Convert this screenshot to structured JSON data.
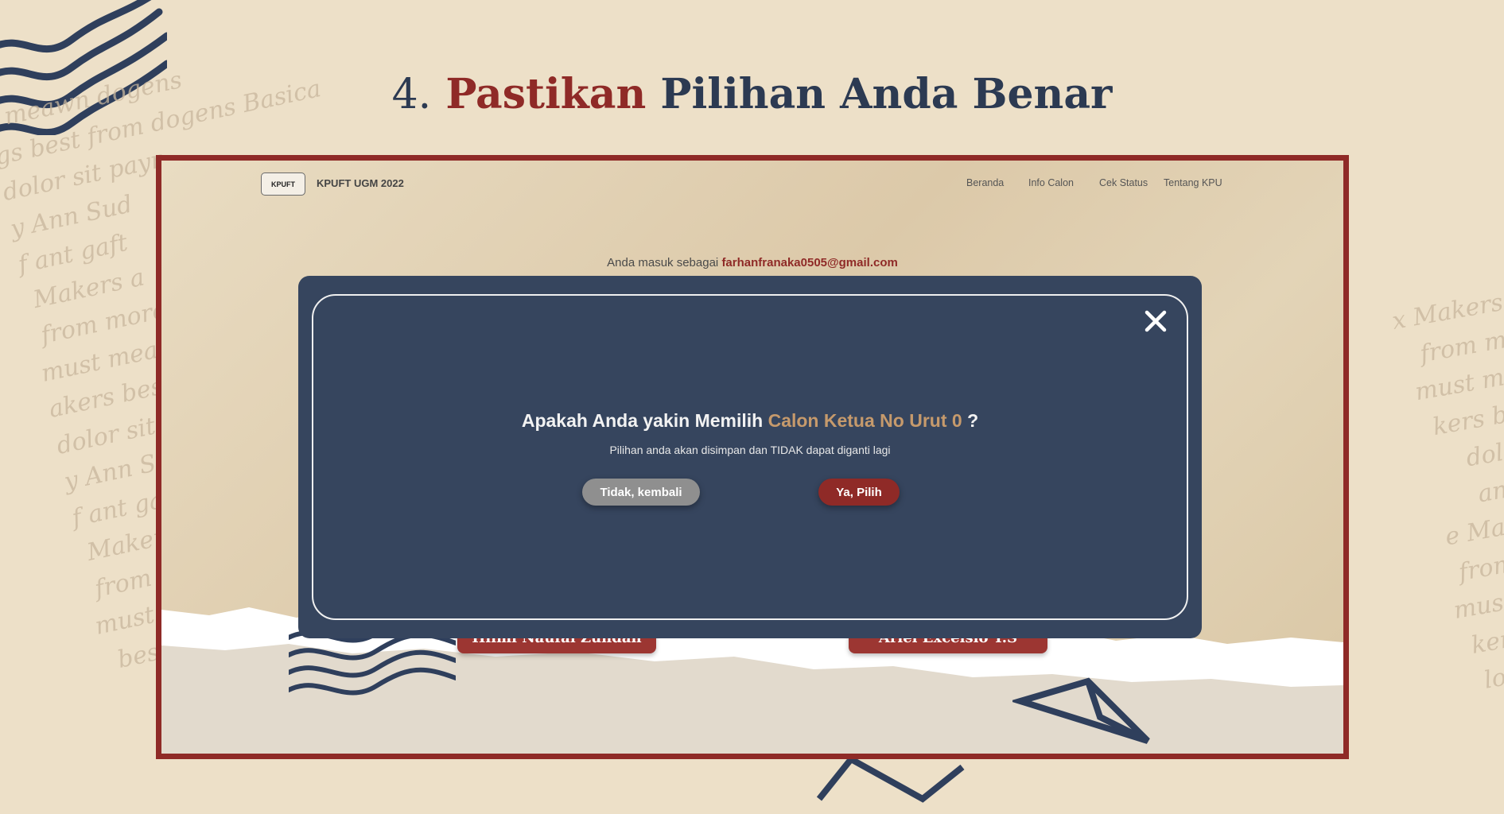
{
  "slide": {
    "step": "4.",
    "title_accent": "Pastikan",
    "title_rest": "Pilihan Anda Benar"
  },
  "site": {
    "logo_text": "KPUFT",
    "brand": "KPUFT UGM 2022",
    "nav": [
      "Beranda",
      "Info Calon",
      "Cek Status",
      "Tentang KPU"
    ],
    "logged_prefix": "Anda masuk sebagai",
    "logged_email": "farhanfranaka0505@gmail.com",
    "candidates": [
      "Hilmi Naufal Zuhdan",
      "Ariel Excelsio T.S"
    ]
  },
  "modal": {
    "question_prefix": "Apakah Anda yakin Memilih",
    "question_highlight": "Calon Ketua No Urut 0",
    "question_suffix": "?",
    "subtitle": "Pilihan anda akan disimpan dan TIDAK dapat diganti lagi",
    "cancel_label": "Tidak, kembali",
    "confirm_label": "Ya, Pilih"
  },
  "icons": {
    "close": "close-icon",
    "logo": "kpuft-logo-icon"
  },
  "colors": {
    "accent": "#8f2a27",
    "navy": "#36455e",
    "highlight": "#c69a6c",
    "background": "#ede0c8"
  }
}
